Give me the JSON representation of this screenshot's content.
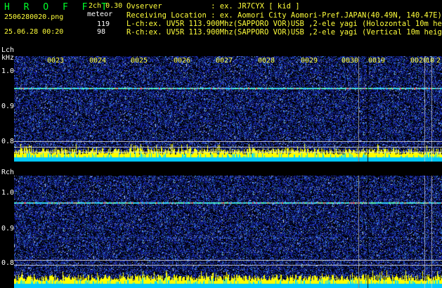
{
  "header": {
    "logo": "H R O F F T",
    "channels": "2ch 0.30",
    "filename": "2506280020.png",
    "mode": "meteor",
    "timestamp": "25.06.28 00:20",
    "count_l": "119",
    "count_r": "98",
    "observer": "Ovserver           : ex. JR7CYX [ kid ]",
    "location": "Receiving Location : ex. Aomori City Aomori-Pref.JAPAN(40.49N, 140.47E)",
    "lch_info": "L-ch:ex. UV5R 113.900Mhz(SAPPORO VOR)USB ,2-ele yagi (Holozontal 10m height)",
    "rch_info": "R-ch:ex. UV5R 113.900Mhz(SAPPORO VOR)USB ,2-ele yagi (Vertical 10m height)"
  },
  "lch": {
    "label": "Lch",
    "unit": "kHz",
    "ticks": [
      "1.0",
      "0.9",
      "0.8"
    ]
  },
  "rch": {
    "label": "Rch",
    "ticks": [
      "1.0",
      "0.9",
      "0.8"
    ]
  },
  "time_labels": [
    "0023",
    "0024",
    "0025",
    "0026",
    "0027",
    "0028",
    "0029",
    "0030",
    "0019",
    "0020",
    "10",
    "2"
  ],
  "colors": {
    "background": "#000000",
    "header_green": "#00ff2a",
    "header_yellow": "#ffff3a",
    "noise_blue": "#1a2aa8",
    "carrier": "#40ffd0",
    "signal_yellow": "#ffff00",
    "signal_cyan": "#00d8ff"
  }
}
